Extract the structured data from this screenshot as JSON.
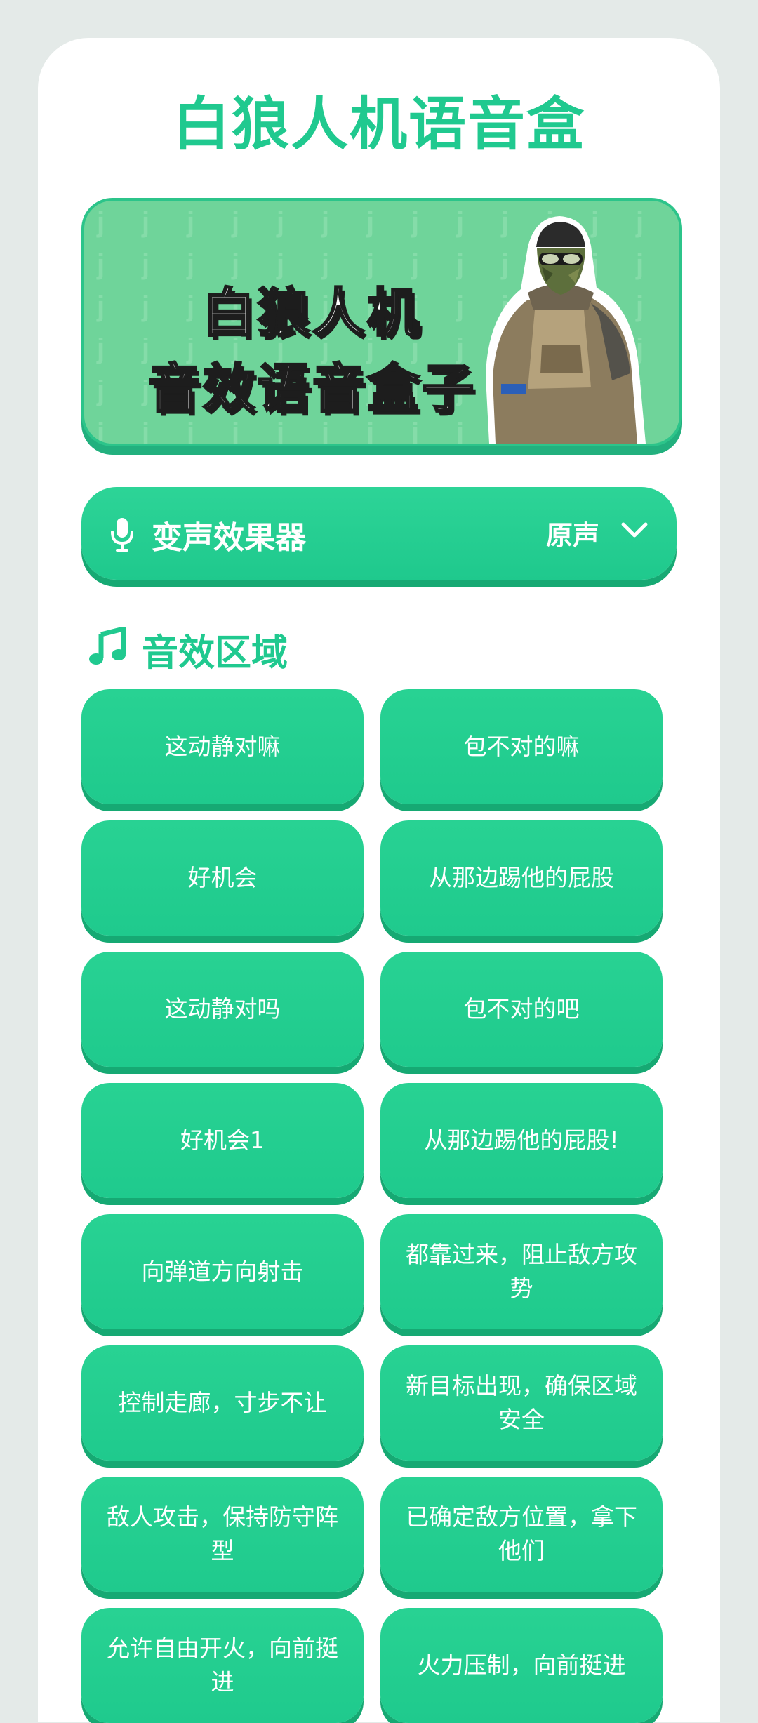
{
  "app": {
    "title": "白狼人机语音盒"
  },
  "banner": {
    "line1": "白狼人机",
    "line2": "音效语音盒子",
    "pattern_glyph": "j",
    "background_color": "#6fd49a"
  },
  "voice_changer": {
    "icon": "microphone-icon",
    "label": "变声效果器",
    "selected_value": "原声",
    "dropdown_icon": "chevron-down-icon"
  },
  "sound_section": {
    "icon": "music-note-icon",
    "title": "音效区域",
    "buttons": [
      "这动静对嘛",
      "包不对的嘛",
      "好机会",
      "从那边踢他的屁股",
      "这动静对吗",
      "包不对的吧",
      "好机会1",
      "从那边踢他的屁股!",
      "向弹道方向射击",
      "都靠过来，阻止敌方攻势",
      "控制走廊，寸步不让",
      "新目标出现，确保区域安全",
      "敌人攻击，保持防守阵型",
      "已确定敌方位置，拿下他们",
      "允许自由开火，向前挺进",
      "火力压制，向前挺进"
    ]
  },
  "colors": {
    "accent": "#20c98f",
    "button": "#1fca8d",
    "button_shadow": "#16a973",
    "card": "#ffffff",
    "page_background": "#e4eae8"
  }
}
